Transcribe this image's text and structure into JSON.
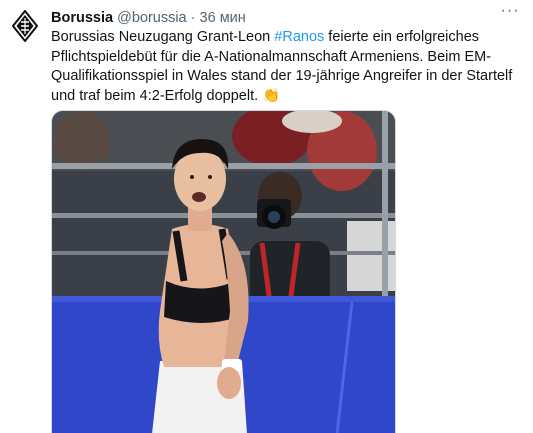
{
  "tweet": {
    "author_name": "Borussia",
    "author_handle": "@borussia",
    "separator": "·",
    "time": "36 мин",
    "text_before_hashtag": "Borussias Neuzugang Grant-Leon ",
    "hashtag": "#Ranos",
    "text_after_hashtag": " feierte ein erfolgreiches Pflichtspieldebüt für die A-Nationalmannschaft Armeniens. Beim EM-Qualifikationsspiel in Wales stand der 19-jährige Angreifer in der Startelf und traf beim 4:2-Erfolg doppelt.",
    "emoji": "👏"
  },
  "icons": {
    "avatar": "borussia-crest-icon",
    "more": "more-options-icon"
  },
  "colors": {
    "hashtag": "#1d9bf0",
    "secondary_text": "#536471",
    "ad_board": "#2f47c8"
  }
}
